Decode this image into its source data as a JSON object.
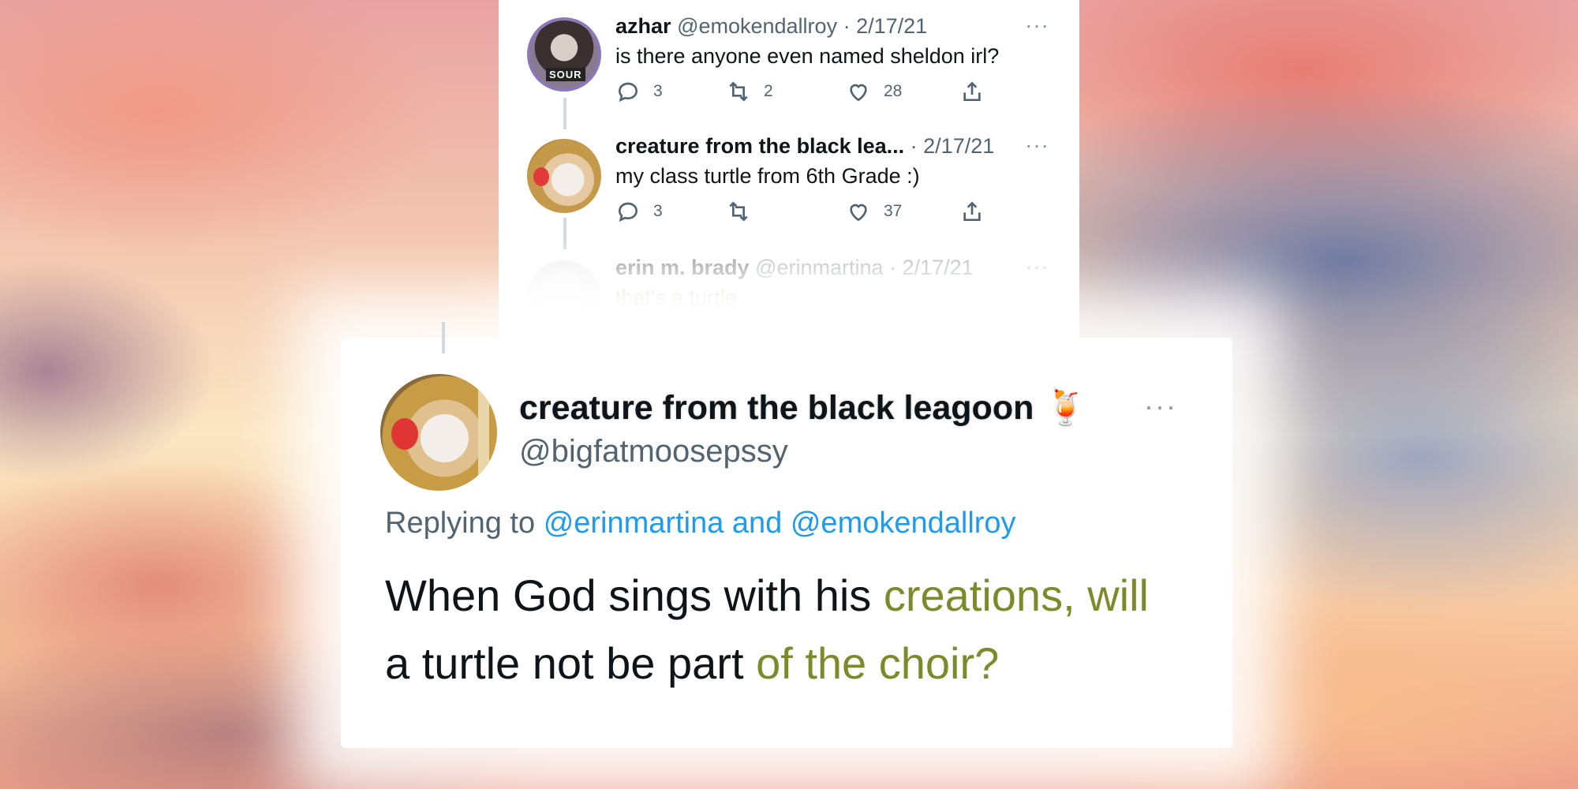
{
  "thread": [
    {
      "name": "azhar",
      "handle": "@emokendallroy",
      "date": "· 2/17/21",
      "text": "is there anyone even named sheldon irl?",
      "avatar_badge": "SOUR",
      "replies": "3",
      "retweets": "2",
      "likes": "28"
    },
    {
      "name": "creature from the black lea...",
      "handle": "",
      "date": "· 2/17/21",
      "text": "my class turtle from 6th Grade :)",
      "replies": "3",
      "retweets": "",
      "likes": "37"
    },
    {
      "name": "erin m. brady",
      "handle": "@erinmartina",
      "date": "· 2/17/21",
      "text": "that's a turtle"
    }
  ],
  "more_label": "···",
  "main_tweet": {
    "name": "creature from the black leagoon",
    "emoji": "🍹",
    "handle": "@bigfatmoosepssy",
    "reply_prefix": "Replying to",
    "reply_mentions": "@erinmartina and @emokendallroy",
    "text_part1": "When God sings with his ",
    "text_part2": "creations, will",
    "text_part3": "a turtle not be part ",
    "text_part4": "of the choir?"
  },
  "colors": {
    "accent": "#1d9bf0",
    "text": "#0f1419",
    "secondary": "#536471",
    "text_tint": "#7c8a2a"
  },
  "icons": [
    "reply-icon",
    "retweet-icon",
    "like-icon",
    "share-icon",
    "more-icon"
  ]
}
